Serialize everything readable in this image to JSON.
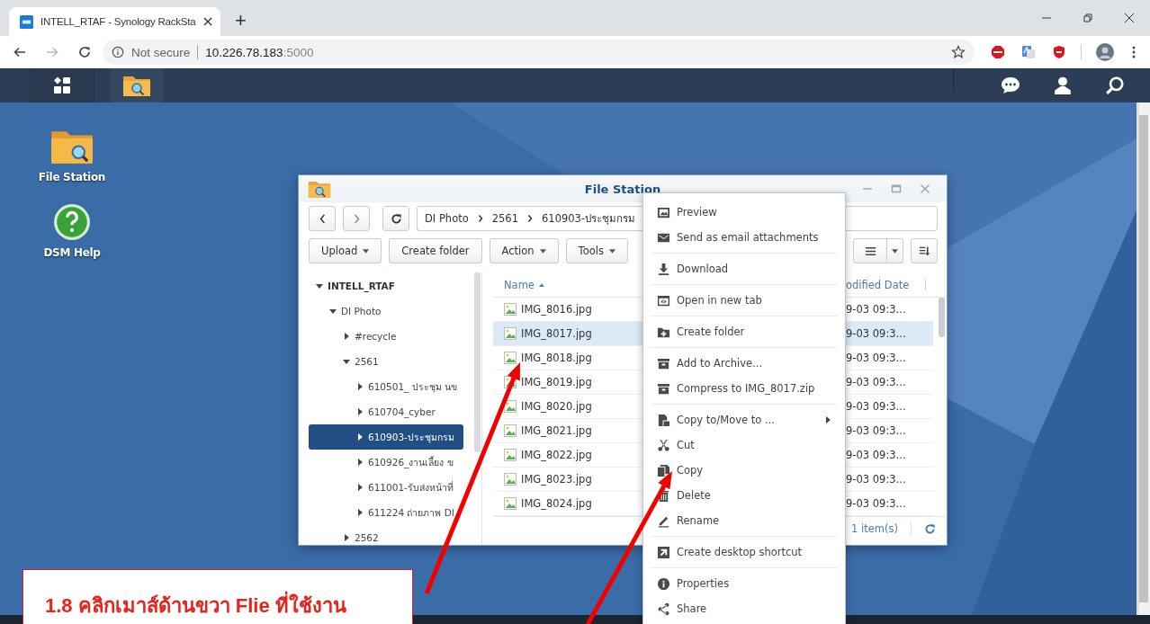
{
  "browser": {
    "tab": {
      "title": "INTELL_RTAF - Synology RackSta",
      "selected": true
    },
    "new_tab": "+",
    "address": {
      "security": "Not secure",
      "host": "10.226.78.183",
      "port": ":5000"
    }
  },
  "desktop_icons": [
    {
      "label": "File Station",
      "kind": "folder"
    },
    {
      "label": "DSM Help",
      "kind": "help"
    }
  ],
  "file_station": {
    "title": "File Station",
    "path": [
      "DI Photo",
      "2561",
      "610903-ประชุมกรม"
    ],
    "toolbar": [
      {
        "label": "Upload",
        "dropdown": true
      },
      {
        "label": "Create folder",
        "dropdown": false
      },
      {
        "label": "Action",
        "dropdown": true
      },
      {
        "label": "Tools",
        "dropdown": true
      }
    ],
    "tree": [
      {
        "label": "INTELL_RTAF",
        "expanded": true,
        "selected": false,
        "children": [
          {
            "label": "DI Photo",
            "expanded": true,
            "selected": false,
            "children": [
              {
                "label": "#recycle",
                "expanded": false,
                "selected": false
              },
              {
                "label": "2561",
                "expanded": true,
                "selected": false,
                "children": [
                  {
                    "label": "610501_ ประชุม นข",
                    "expanded": false,
                    "selected": false
                  },
                  {
                    "label": "610704_cyber",
                    "expanded": false,
                    "selected": false
                  },
                  {
                    "label": "610903-ประชุมกรม",
                    "expanded": false,
                    "selected": true
                  },
                  {
                    "label": "610926_งานเลี้ยง ข",
                    "expanded": false,
                    "selected": false
                  },
                  {
                    "label": "611001-รับส่งหน้าที่",
                    "expanded": false,
                    "selected": false
                  },
                  {
                    "label": "611224 ถ่ายภาพ DI",
                    "expanded": false,
                    "selected": false
                  }
                ]
              },
              {
                "label": "2562",
                "expanded": false,
                "selected": false
              }
            ]
          }
        ]
      }
    ],
    "columns": [
      {
        "label": "Name",
        "sorted": true
      },
      {
        "label": "odified Date",
        "sorted": false
      }
    ],
    "files": [
      {
        "name": "IMG_8016.jpg",
        "modified": "9-03 09:3...",
        "selected": false
      },
      {
        "name": "IMG_8017.jpg",
        "modified": "9-03 09:3...",
        "selected": true
      },
      {
        "name": "IMG_8018.jpg",
        "modified": "9-03 09:3...",
        "selected": false
      },
      {
        "name": "IMG_8019.jpg",
        "modified": "9-03 09:3...",
        "selected": false
      },
      {
        "name": "IMG_8020.jpg",
        "modified": "9-03 09:3...",
        "selected": false
      },
      {
        "name": "IMG_8021.jpg",
        "modified": "9-03 09:3...",
        "selected": false
      },
      {
        "name": "IMG_8022.jpg",
        "modified": "9-03 09:3...",
        "selected": false
      },
      {
        "name": "IMG_8023.jpg",
        "modified": "9-03 09:3...",
        "selected": false
      },
      {
        "name": "IMG_8024.jpg",
        "modified": "9-03 09:3...",
        "selected": false
      }
    ],
    "status": "1 item(s)"
  },
  "context_menu": [
    [
      {
        "label": "Preview",
        "submenu": false
      },
      {
        "label": "Send as email attachments",
        "submenu": false
      }
    ],
    [
      {
        "label": "Download",
        "submenu": false
      }
    ],
    [
      {
        "label": "Open in new tab",
        "submenu": false
      }
    ],
    [
      {
        "label": "Create folder",
        "submenu": false
      }
    ],
    [
      {
        "label": "Add to Archive...",
        "submenu": false
      },
      {
        "label": "Compress to IMG_8017.zip",
        "submenu": false
      }
    ],
    [
      {
        "label": "Copy to/Move to ...",
        "submenu": true
      },
      {
        "label": "Cut",
        "submenu": false
      },
      {
        "label": "Copy",
        "submenu": false
      },
      {
        "label": "Delete",
        "submenu": false
      },
      {
        "label": "Rename",
        "submenu": false
      }
    ],
    [
      {
        "label": "Create desktop shortcut",
        "submenu": false
      }
    ],
    [
      {
        "label": "Properties",
        "submenu": false
      },
      {
        "label": "Share",
        "submenu": false
      }
    ]
  ],
  "annotation": {
    "text": "1.8 คลิกเมาส์ด้านขวา Flie ที่ใช้งาน"
  }
}
